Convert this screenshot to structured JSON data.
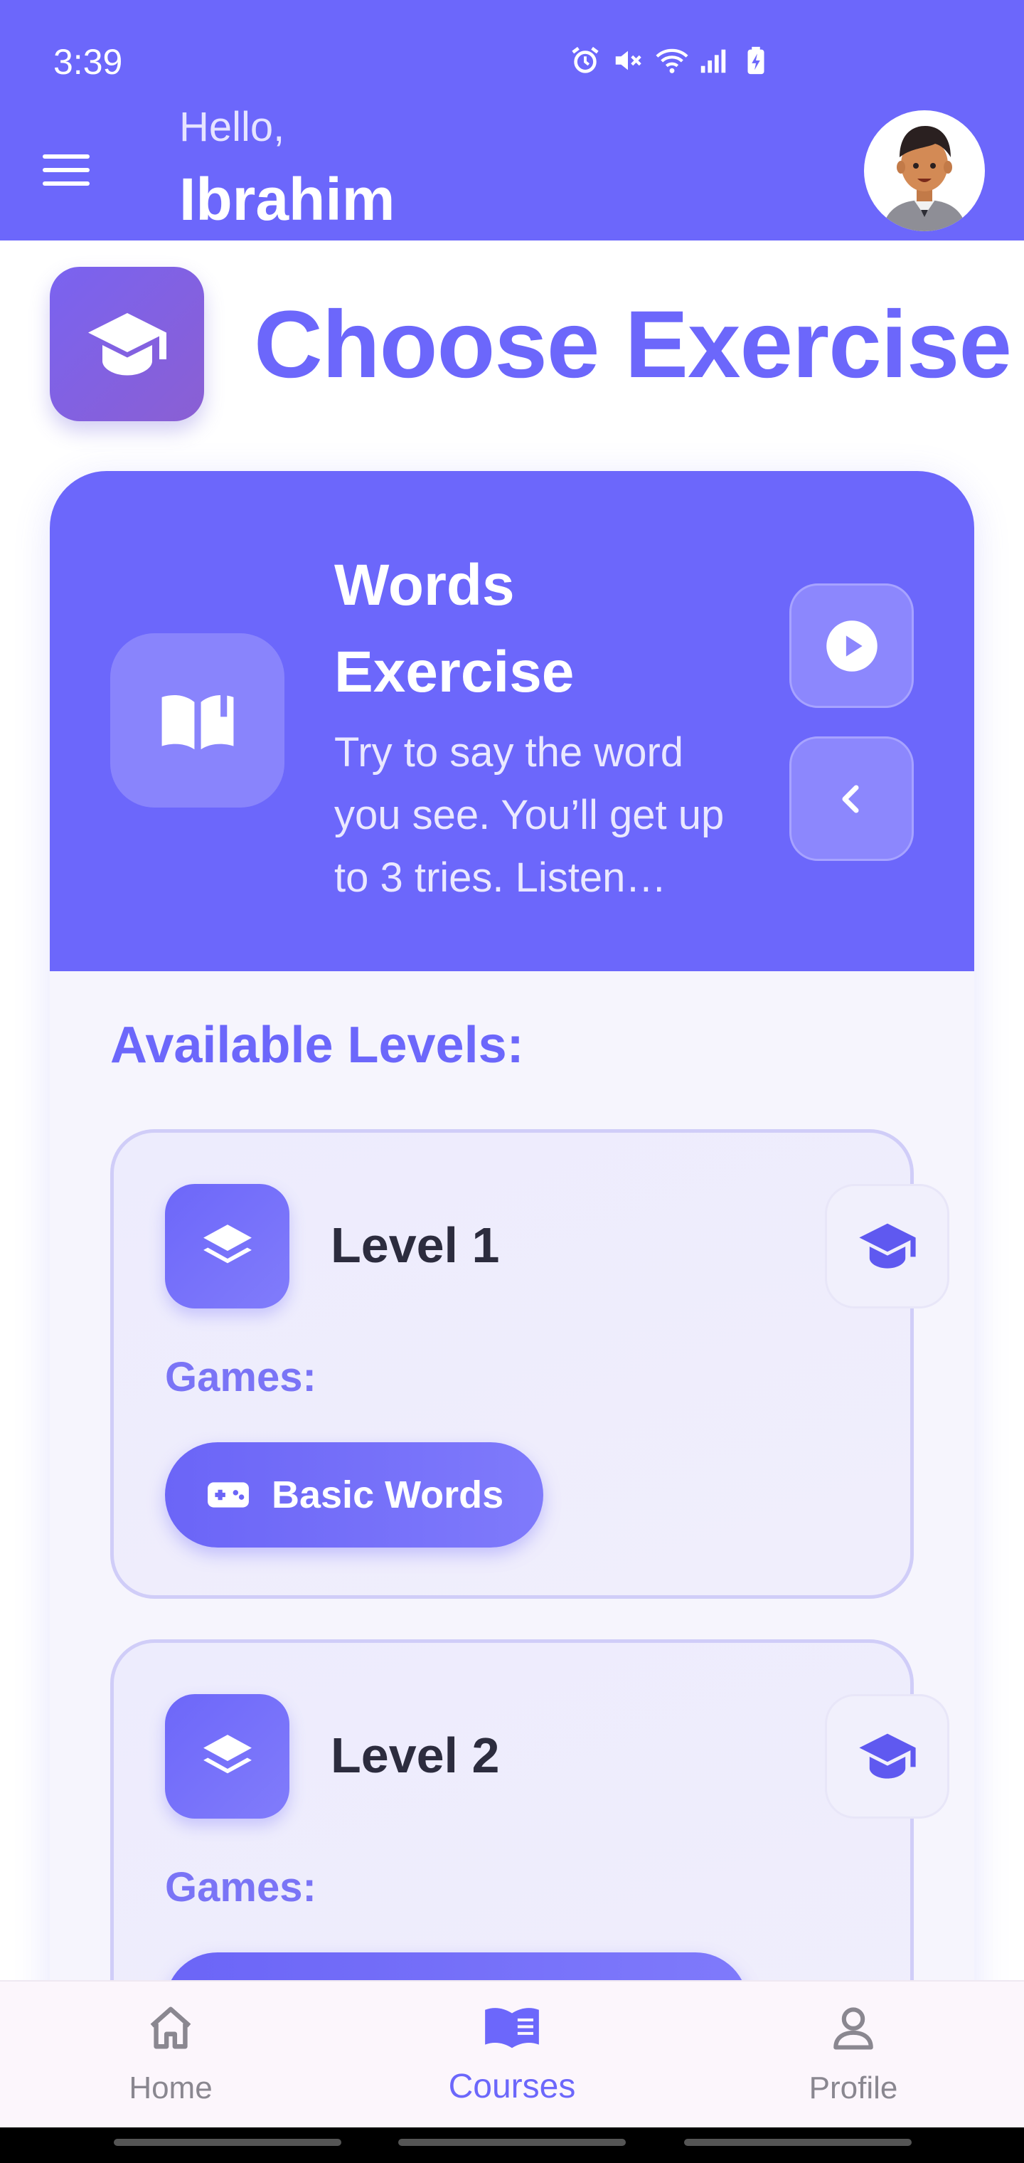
{
  "status_bar": {
    "time": "3:39"
  },
  "header": {
    "greeting": "Hello,",
    "user_name": "Ibrahim"
  },
  "page": {
    "title": "Choose Exercise"
  },
  "exercise": {
    "title": "Words Exercise",
    "description": "Try to say the word you see. You’ll get up to 3 tries. Listen…"
  },
  "levels_section": {
    "title": "Available Levels:",
    "levels": [
      {
        "name": "Level 1",
        "games_label": "Games:",
        "games": [
          "Basic Words"
        ]
      },
      {
        "name": "Level 2",
        "games_label": "Games:",
        "games": [
          ""
        ]
      }
    ]
  },
  "bottom_nav": {
    "items": [
      {
        "label": "Home"
      },
      {
        "label": "Courses"
      },
      {
        "label": "Profile"
      }
    ],
    "active_index": 1
  },
  "colors": {
    "accent": "#6c67fb",
    "surface": "#f6f5fd",
    "nav_bg": "#fcf6fc"
  }
}
